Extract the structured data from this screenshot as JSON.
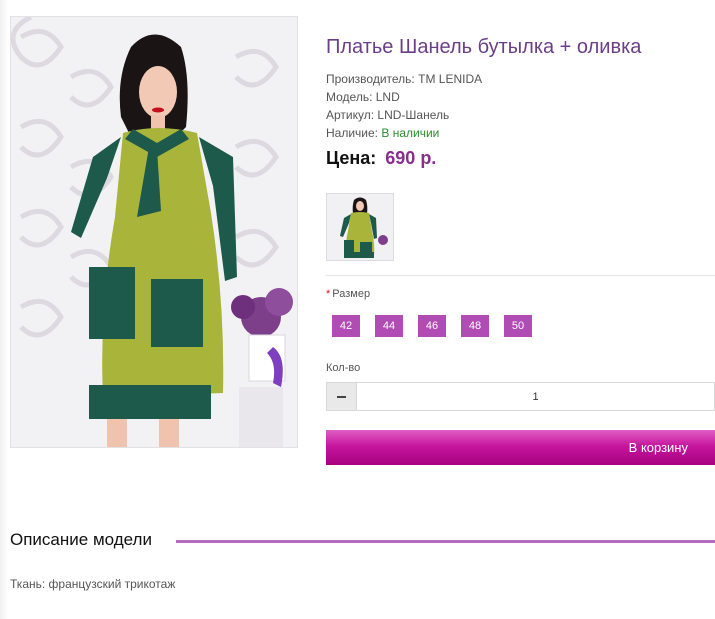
{
  "product": {
    "title": "Платье Шанель бутылка + оливка",
    "manufacturer": {
      "label": "Производитель:",
      "value": "TM LENIDA"
    },
    "model": {
      "label": "Модель:",
      "value": "LND"
    },
    "sku": {
      "label": "Артикул:",
      "value": "LND-Шанель"
    },
    "availability": {
      "label": "Наличие:",
      "value": "В наличии"
    },
    "price": {
      "label": "Цена:",
      "value": "690 р."
    }
  },
  "options": {
    "size": {
      "required_mark": "*",
      "label": "Размер",
      "values": [
        "42",
        "44",
        "46",
        "48",
        "50"
      ]
    },
    "quantity": {
      "label": "Кол-во",
      "value": "1"
    }
  },
  "cart_button": {
    "label": "В корзину"
  },
  "description": {
    "heading": "Описание модели",
    "text": "Ткань: французский трикотаж"
  },
  "colors": {
    "title": "#6b3f88",
    "price": "#8a2d8f",
    "size_button": "#b14cb4",
    "cart_button": "#c6179e",
    "in_stock": "#2e8b2e",
    "description_line": "#b56bc0"
  },
  "icons": {
    "quantity_decrease": "minus-icon"
  }
}
